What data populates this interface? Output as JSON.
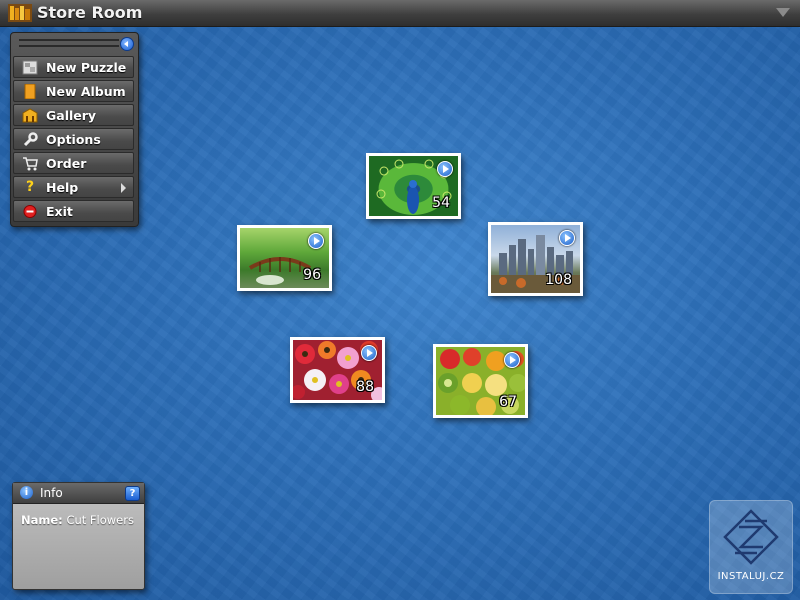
{
  "app": {
    "title": "Store Room",
    "title_icon": "bookshelf-icon"
  },
  "menu": {
    "items": [
      {
        "label": "New Puzzle",
        "icon": "puzzle-icon"
      },
      {
        "label": "New Album",
        "icon": "album-icon"
      },
      {
        "label": "Gallery",
        "icon": "gallery-icon"
      },
      {
        "label": "Options",
        "icon": "wrench-icon"
      },
      {
        "label": "Order",
        "icon": "cart-icon"
      },
      {
        "label": "Help",
        "icon": "help-icon",
        "has_submenu": true
      },
      {
        "label": "Exit",
        "icon": "exit-icon"
      }
    ]
  },
  "puzzles": [
    {
      "subject": "peacock",
      "pieces": "54"
    },
    {
      "subject": "bridge",
      "pieces": "96"
    },
    {
      "subject": "city",
      "pieces": "108"
    },
    {
      "subject": "flowers",
      "pieces": "88"
    },
    {
      "subject": "fruit",
      "pieces": "67"
    }
  ],
  "info": {
    "title": "Info",
    "name_label": "Name:",
    "name_value": "Cut Flowers",
    "help_glyph": "?"
  },
  "watermark": {
    "text": "INSTALUJ.CZ"
  },
  "colors": {
    "background": "#2d6fb8",
    "accent": "#1b5fc9"
  }
}
